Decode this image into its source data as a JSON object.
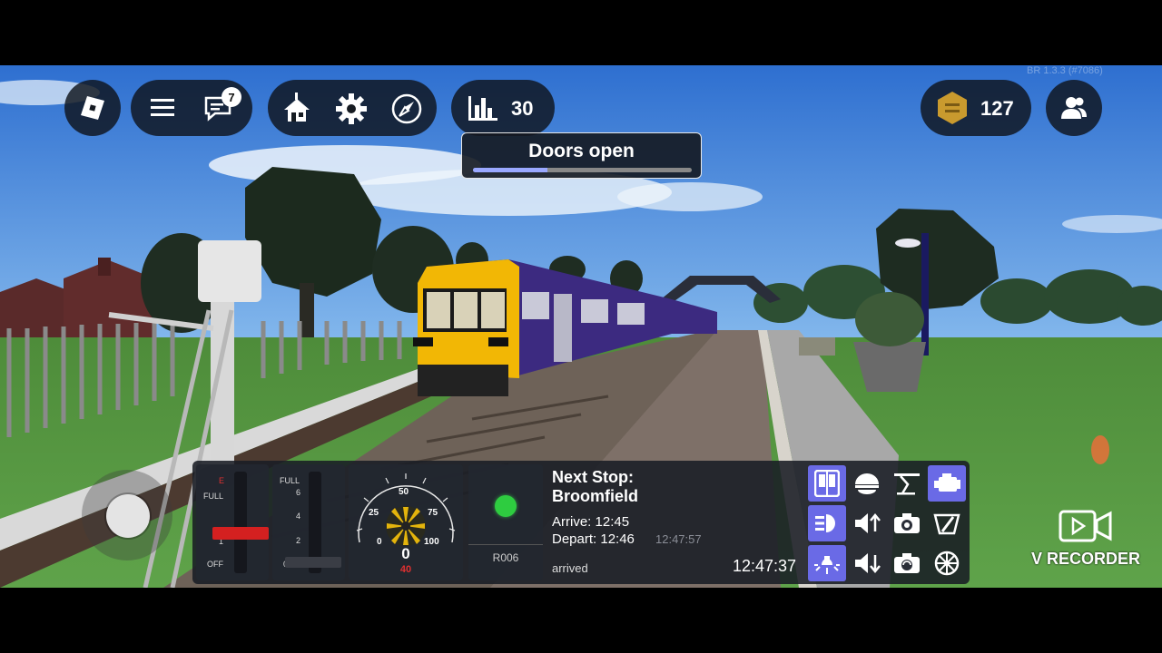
{
  "hud": {
    "chat_badge": "7",
    "stats_value": "30",
    "coins_value": "127",
    "version": "BR 1.3.3 (#7086)"
  },
  "notification": {
    "text": "Doors open",
    "progress": 0.34
  },
  "driver_panel": {
    "brake": {
      "labels": [
        "E",
        "FULL",
        "1",
        "OFF"
      ],
      "position": 0.33
    },
    "power": {
      "labels": [
        "FULL",
        "6",
        "4",
        "2",
        "0"
      ],
      "position": 1.0
    },
    "speedometer": {
      "ticks": [
        "0",
        "25",
        "50",
        "75",
        "100"
      ],
      "speed": "0",
      "limit": "40"
    },
    "signal": {
      "id": "R006",
      "color": "#2ecc40"
    },
    "next_stop": {
      "title_line1": "Next Stop:",
      "title_line2": "Broomfield",
      "arrive": "Arrive: 12:45",
      "depart": "Depart: 12:46",
      "depart_actual": "12:47:57",
      "status": "arrived",
      "clock": "12:47:37"
    },
    "controls": [
      {
        "name": "doors-icon",
        "active": true
      },
      {
        "name": "horn-icon",
        "active": false
      },
      {
        "name": "pantograph-icon",
        "active": false
      },
      {
        "name": "engine-icon",
        "active": true
      },
      {
        "name": "headlight-icon",
        "active": true
      },
      {
        "name": "volume-up-icon",
        "active": false
      },
      {
        "name": "camera-icon",
        "active": false
      },
      {
        "name": "wiper-icon",
        "active": false
      },
      {
        "name": "cab-light-icon",
        "active": true
      },
      {
        "name": "volume-down-icon",
        "active": false
      },
      {
        "name": "camera-switch-icon",
        "active": false
      },
      {
        "name": "handbrake-icon",
        "active": false
      }
    ]
  },
  "watermark": {
    "text": "V RECORDER"
  },
  "colors": {
    "accent": "#6a6ae6",
    "train_yellow": "#f2b705",
    "train_purple": "#3c2a80",
    "coin": "#c99a2e"
  }
}
